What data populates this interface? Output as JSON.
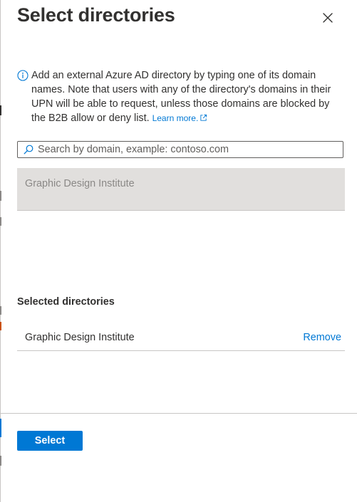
{
  "panel": {
    "title": "Select directories",
    "close_icon": "close-icon"
  },
  "info": {
    "icon": "info-icon",
    "text": "Add an external Azure AD directory by typing one of its domain names. Note that users with any of the directory's domains in their UPN will be able to request, unless those domains are blocked by the B2B allow or deny list.",
    "learn_more_label": "Learn more.",
    "learn_more_icon": "external-link-icon"
  },
  "search": {
    "icon": "search-icon",
    "placeholder": "Search by domain, example: contoso.com",
    "value": ""
  },
  "search_results": [
    {
      "name": "Graphic Design Institute",
      "state": "disabled"
    }
  ],
  "selected_directories": {
    "heading": "Selected directories",
    "items": [
      {
        "name": "Graphic Design Institute",
        "remove_label": "Remove"
      }
    ]
  },
  "footer": {
    "select_label": "Select"
  },
  "colors": {
    "accent": "#0078d4",
    "text": "#323130",
    "muted_text": "#8a8886",
    "disabled_row": "#e1dfdd",
    "divider": "#c8c6c4"
  }
}
